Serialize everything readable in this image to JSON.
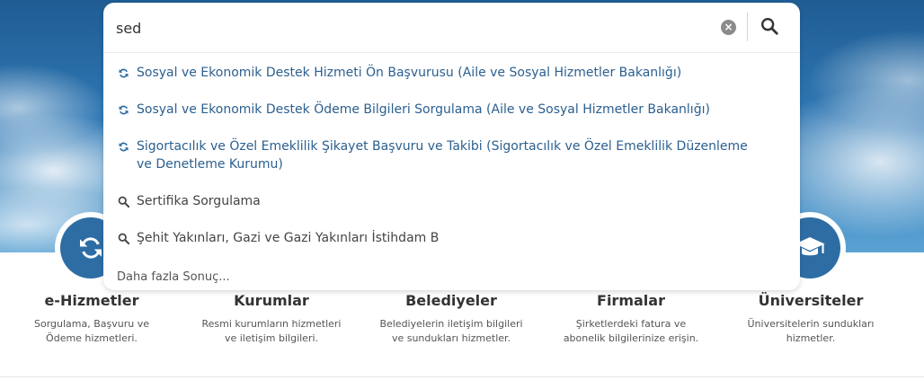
{
  "search": {
    "query": "sed",
    "more_label": "Daha fazla Sonuç..."
  },
  "results": [
    {
      "icon": "service-refresh-icon",
      "label": "Sosyal ve Ekonomik Destek Hizmeti Ön Başvurusu (Aile ve Sosyal Hizmetler Bakanlığı)"
    },
    {
      "icon": "service-refresh-icon",
      "label": "Sosyal ve Ekonomik Destek Ödeme Bilgileri Sorgulama (Aile ve Sosyal Hizmetler Bakanlığı)"
    },
    {
      "icon": "service-refresh-icon",
      "label": "Sigortacılık ve Özel Emeklilik Şikayet Başvuru ve Takibi (Sigortacılık ve Özel Emeklilik Düzenleme ve Denetleme Kurumu)"
    },
    {
      "icon": "search-icon",
      "label": "Sertifika Sorgulama"
    },
    {
      "icon": "search-icon",
      "label": "Şehit Yakınları, Gazi ve Gazi Yakınları İstihdam B"
    }
  ],
  "categories": [
    {
      "title": "e-Hizmetler",
      "desc": "Sorgulama, Başvuru ve Ödeme hizmetleri."
    },
    {
      "title": "Kurumlar",
      "desc": "Resmi kurumların hizmetleri ve iletişim bilgileri."
    },
    {
      "title": "Belediyeler",
      "desc": "Belediyelerin iletişim bilgileri ve sundukları hizmetler."
    },
    {
      "title": "Firmalar",
      "desc": "Şirketlerdeki fatura ve abonelik bilgilerinize erişin."
    },
    {
      "title": "Üniversiteler",
      "desc": "Üniversitelerin sundukları hizmetler."
    }
  ],
  "colors": {
    "accent": "#2e6da4",
    "link": "#2b5f8f"
  }
}
